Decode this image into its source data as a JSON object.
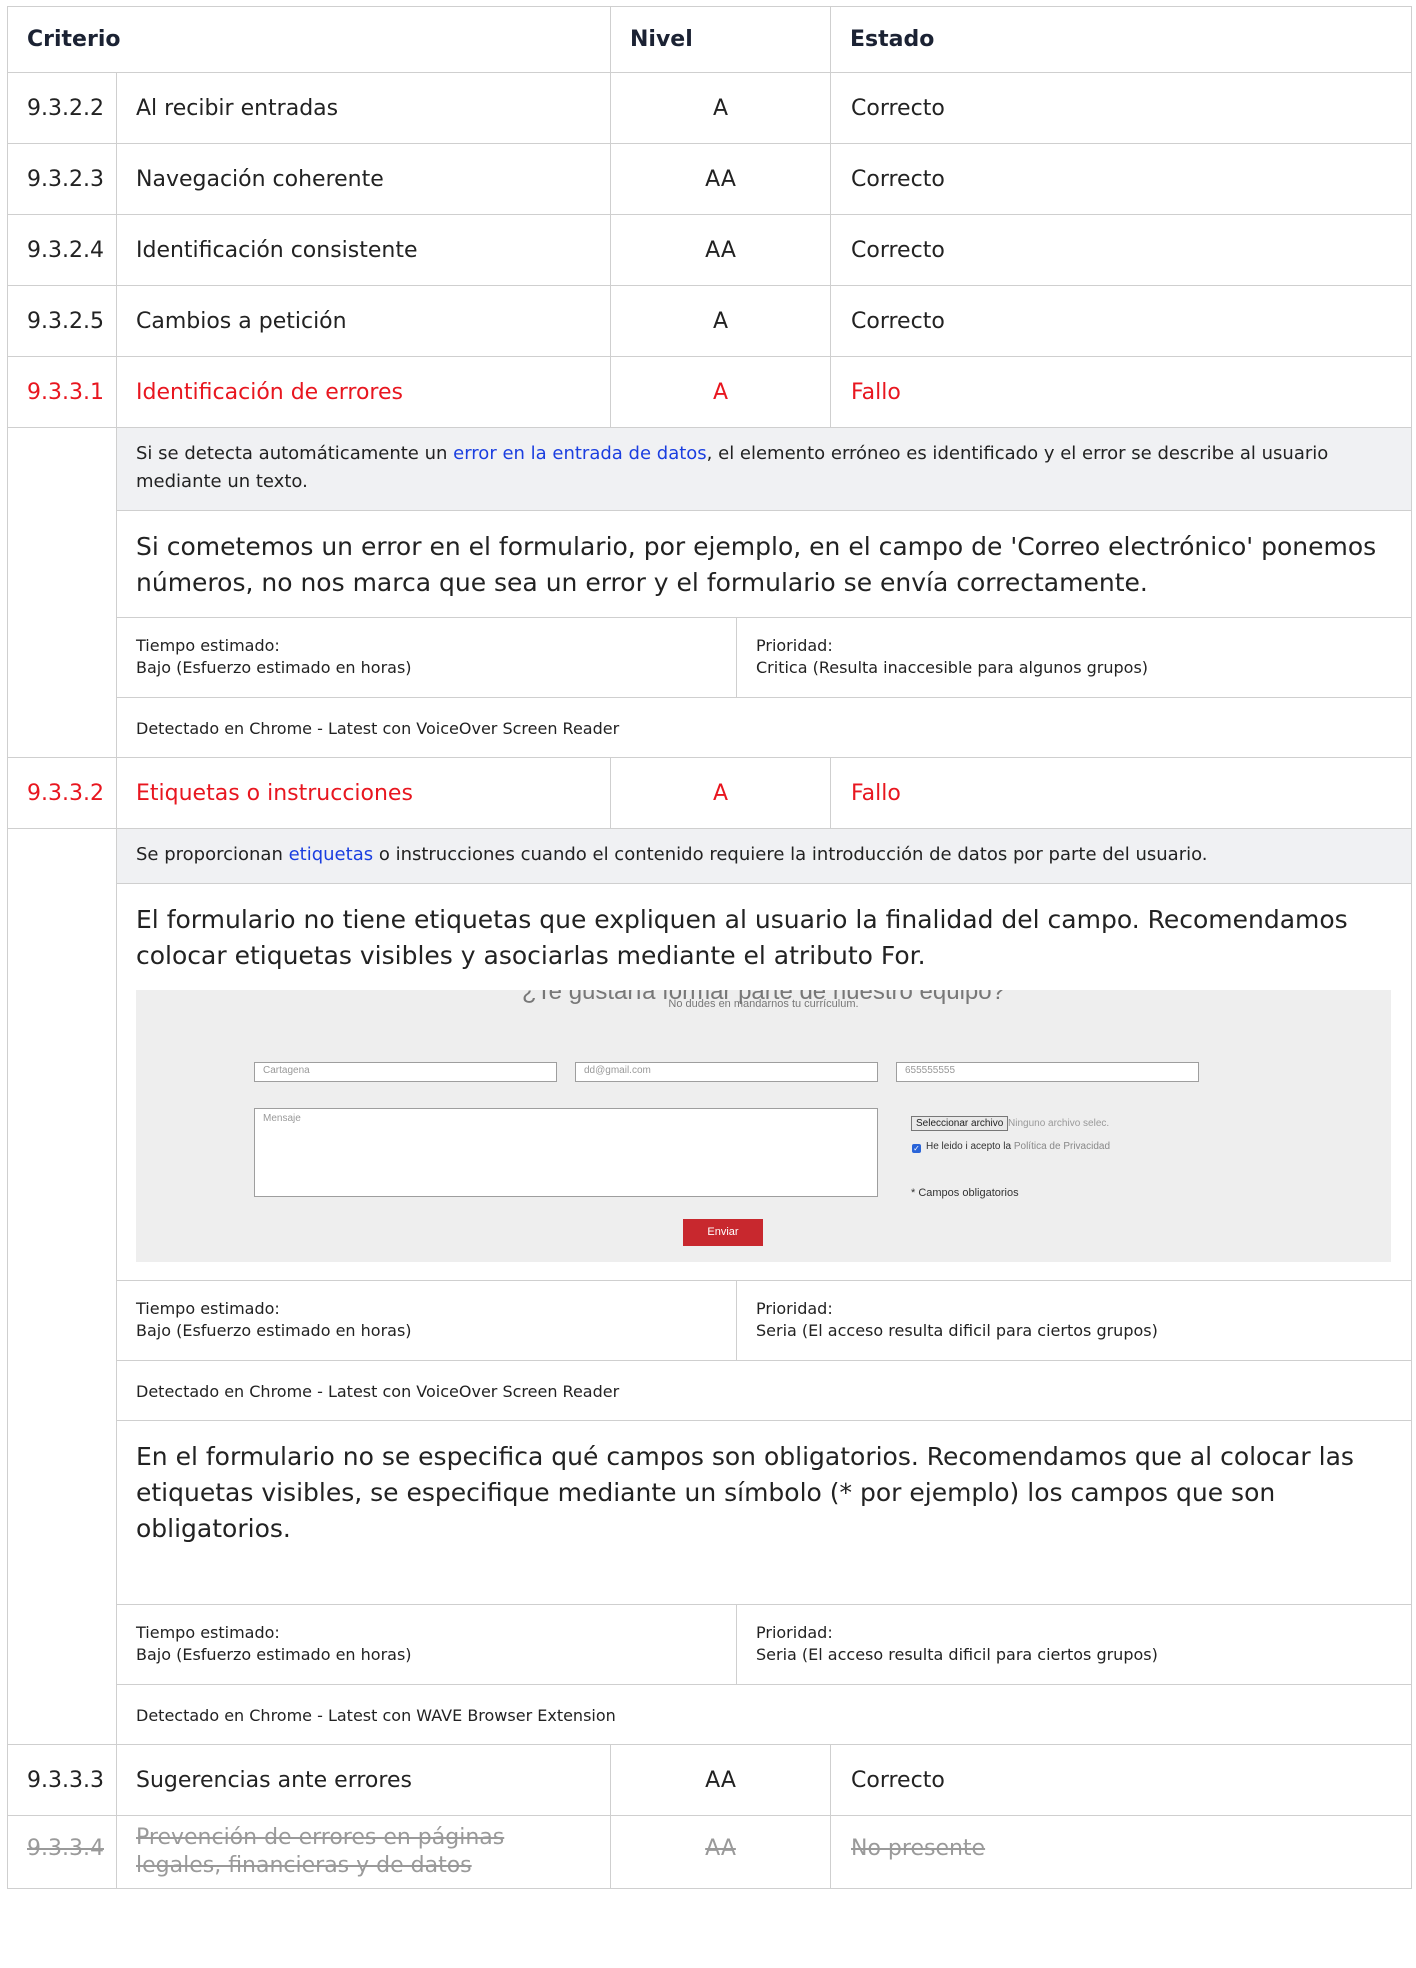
{
  "header": {
    "criterio": "Criterio",
    "nivel": "Nivel",
    "estado": "Estado"
  },
  "rows": [
    {
      "code": "9.3.2.2",
      "name": "Al recibir entradas",
      "level": "A",
      "status": "Correcto"
    },
    {
      "code": "9.3.2.3",
      "name": "Navegación coherente",
      "level": "AA",
      "status": "Correcto"
    },
    {
      "code": "9.3.2.4",
      "name": "Identificación consistente",
      "level": "AA",
      "status": "Correcto"
    },
    {
      "code": "9.3.2.5",
      "name": "Cambios a petición",
      "level": "A",
      "status": "Correcto"
    },
    {
      "code": "9.3.3.1",
      "name": "Identificación de errores",
      "level": "A",
      "status": "Fallo"
    },
    {
      "code": "9.3.3.2",
      "name": "Etiquetas o instrucciones",
      "level": "A",
      "status": "Fallo"
    },
    {
      "code": "9.3.3.3",
      "name": "Sugerencias ante errores",
      "level": "AA",
      "status": "Correcto"
    },
    {
      "code": "9.3.3.4",
      "name": "Prevención de errores en páginas legales, financieras y de datos",
      "level": "AA",
      "status": "No presente"
    }
  ],
  "detail1": {
    "desc_before": "Si se detecta automáticamente un ",
    "desc_link": "error en la entrada de datos",
    "desc_after": ", el elemento erróneo es identificado y el error se describe al usuario mediante un texto.",
    "observation": "Si cometemos un error en el formulario, por ejemplo, en el campo de 'Correo electrónico' ponemos números, no nos marca que sea un error y el formulario se envía correctamente.",
    "tiempo_label": "Tiempo estimado:",
    "tiempo_value": "Bajo (Esfuerzo estimado en horas)",
    "prioridad_label": "Prioridad:",
    "prioridad_value": "Critica (Resulta inaccesible para algunos grupos)",
    "detected": "Detectado en Chrome - Latest con VoiceOver Screen Reader"
  },
  "detail2": {
    "desc_before": "Se proporcionan ",
    "desc_link": "etiquetas",
    "desc_after": " o instrucciones cuando el contenido requiere la introducción de datos por parte del usuario.",
    "issue1": {
      "observation": "El formulario no tiene etiquetas que expliquen al usuario la finalidad del campo. Recomendamos colocar etiquetas visibles y asociarlas mediante el atributo For.",
      "screenshot": {
        "heading": "¿Te gustaría formar parte de nuestro equipo?",
        "subheading": "No dudes en mandarnos tu currículum.",
        "field_city": "Cartagena",
        "field_email": "dd@gmail.com",
        "field_phone": "655555555",
        "field_message": "Mensaje",
        "file_button": "Seleccionar archivo",
        "file_text": "Ninguno archivo selec.",
        "checkbox_text": "He leido i acepto la",
        "checkbox_link": "Política de Privacidad",
        "required_note": "* Campos obligatorios",
        "send_button": "Enviar"
      },
      "tiempo_label": "Tiempo estimado:",
      "tiempo_value": "Bajo (Esfuerzo estimado en horas)",
      "prioridad_label": "Prioridad:",
      "prioridad_value": "Seria (El acceso resulta dificil para ciertos grupos)",
      "detected": "Detectado en Chrome - Latest con VoiceOver Screen Reader"
    },
    "issue2": {
      "observation": "En el formulario no se especifica qué campos son obligatorios. Recomendamos que al colocar las etiquetas visibles, se especifique mediante un símbolo (* por ejemplo) los campos que son obligatorios.",
      "tiempo_label": "Tiempo estimado:",
      "tiempo_value": "Bajo (Esfuerzo estimado en horas)",
      "prioridad_label": "Prioridad:",
      "prioridad_value": "Seria (El acceso resulta dificil para ciertos grupos)",
      "detected": "Detectado en Chrome - Latest con WAVE Browser Extension"
    }
  },
  "colors": {
    "fail": "#e8161f",
    "link": "#1a3ee0",
    "muted": "#9a9a9a",
    "header_text": "#1b2233",
    "send_button": "#c8282e"
  }
}
